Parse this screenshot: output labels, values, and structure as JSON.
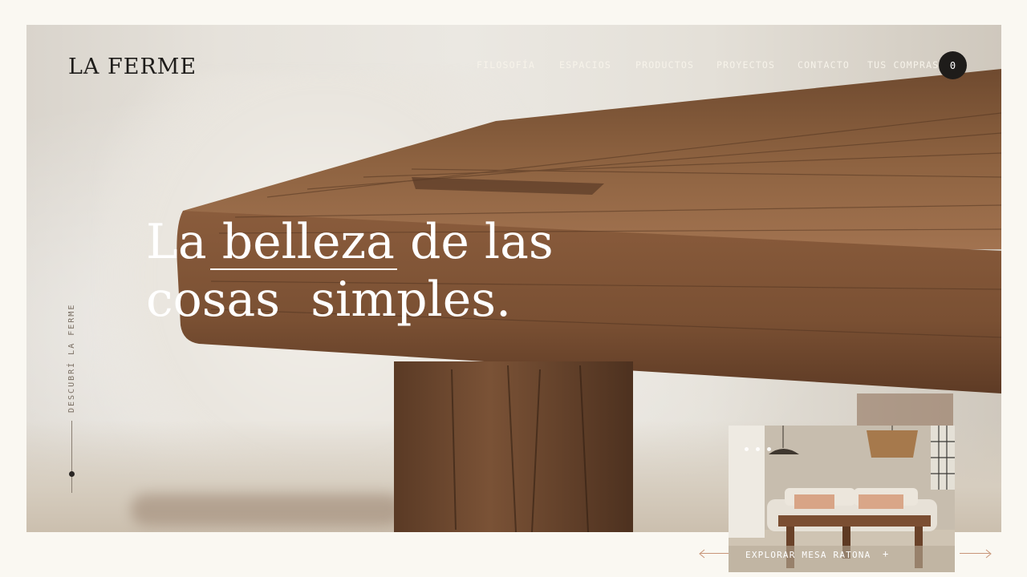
{
  "brand": {
    "logo": "LA FERME"
  },
  "nav": {
    "items": [
      {
        "label": "FILOSOFÍA"
      },
      {
        "label": "ESPACIOS"
      },
      {
        "label": "PRODUCTOS"
      },
      {
        "label": "PROYECTOS"
      },
      {
        "label": "CONTACTO"
      },
      {
        "label": "TUS COMPRAS"
      }
    ],
    "cart_count": "0"
  },
  "hero": {
    "headline_line1": "La belleza de las",
    "headline_line2": "cosas  simples.",
    "side_label": "DESCUBRÍ LA FERME"
  },
  "thumbnail": {
    "caption": "EXPLORAR MESA RATONA",
    "plus": "+"
  },
  "colors": {
    "background": "#faf8f2",
    "wood": "#8a5a3a",
    "dark": "#1e1c1a",
    "accent_arrow": "#c79578"
  }
}
